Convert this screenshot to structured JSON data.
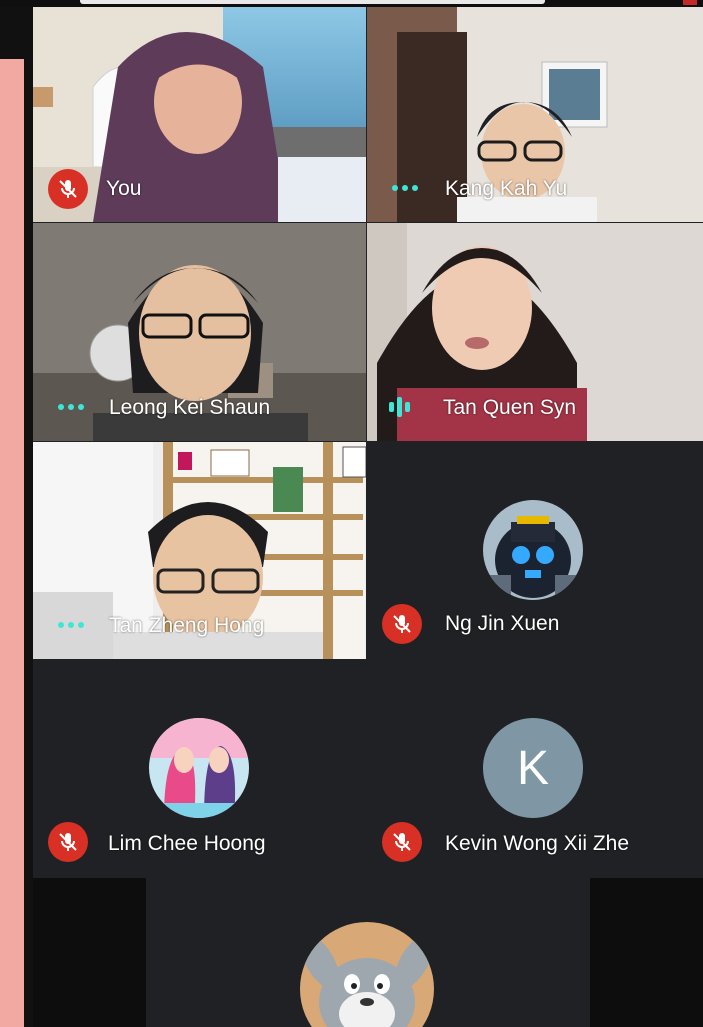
{
  "participants": [
    {
      "name": "You",
      "status": "muted"
    },
    {
      "name": "Kang Kah Yu",
      "status": "speaking-dots"
    },
    {
      "name": "Leong Kei Shaun",
      "status": "speaking-dots"
    },
    {
      "name": "Tan Quen Syn",
      "status": "speaking"
    },
    {
      "name": "Tan Zheng Hong",
      "status": "speaking-dots"
    },
    {
      "name": "Ng Jin Xuen",
      "status": "muted"
    },
    {
      "name": "Lim Chee Hoong",
      "status": "muted"
    },
    {
      "name": "Kevin Wong Xii Zhe",
      "status": "muted",
      "initial": "K"
    },
    {
      "name": "",
      "status": "avatar-only"
    }
  ],
  "colors": {
    "muted_red": "#d93025",
    "speaking_teal": "#3ee6d8",
    "tile_bg": "#202124",
    "k_avatar": "#7f97a4",
    "side_pink": "#f2a9a2"
  },
  "icons": {
    "muted": "mic-off-icon",
    "speaking": "audio-level-icon"
  }
}
